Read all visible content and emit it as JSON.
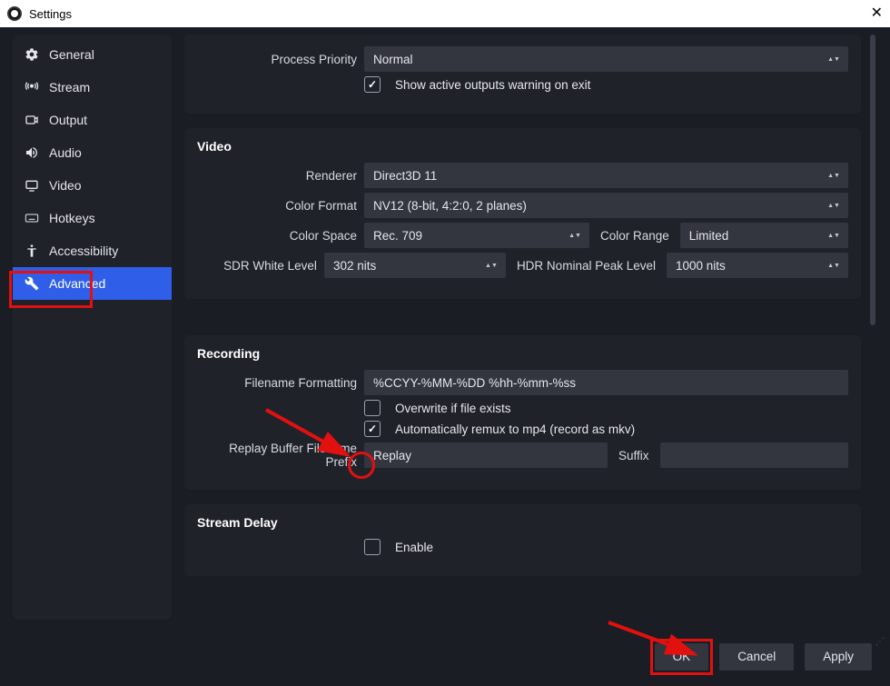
{
  "window": {
    "title": "Settings"
  },
  "sidebar": {
    "items": [
      {
        "label": "General"
      },
      {
        "label": "Stream"
      },
      {
        "label": "Output"
      },
      {
        "label": "Audio"
      },
      {
        "label": "Video"
      },
      {
        "label": "Hotkeys"
      },
      {
        "label": "Accessibility"
      },
      {
        "label": "Advanced"
      }
    ]
  },
  "general": {
    "process_priority_label": "Process Priority",
    "process_priority_value": "Normal",
    "show_active_outputs_label": "Show active outputs warning on exit"
  },
  "video": {
    "section_title": "Video",
    "renderer_label": "Renderer",
    "renderer_value": "Direct3D 11",
    "color_format_label": "Color Format",
    "color_format_value": "NV12 (8-bit, 4:2:0, 2 planes)",
    "color_space_label": "Color Space",
    "color_space_value": "Rec. 709",
    "color_range_label": "Color Range",
    "color_range_value": "Limited",
    "sdr_white_label": "SDR White Level",
    "sdr_white_value": "302 nits",
    "hdr_peak_label": "HDR Nominal Peak Level",
    "hdr_peak_value": "1000 nits"
  },
  "recording": {
    "section_title": "Recording",
    "filename_formatting_label": "Filename Formatting",
    "filename_formatting_value": "%CCYY-%MM-%DD %hh-%mm-%ss",
    "overwrite_label": "Overwrite if file exists",
    "remux_label": "Automatically remux to mp4 (record as mkv)",
    "replay_prefix_label": "Replay Buffer Filename Prefix",
    "replay_prefix_value": "Replay",
    "suffix_label": "Suffix",
    "suffix_value": ""
  },
  "stream_delay": {
    "section_title": "Stream Delay",
    "enable_label": "Enable"
  },
  "buttons": {
    "ok": "OK",
    "cancel": "Cancel",
    "apply": "Apply"
  }
}
